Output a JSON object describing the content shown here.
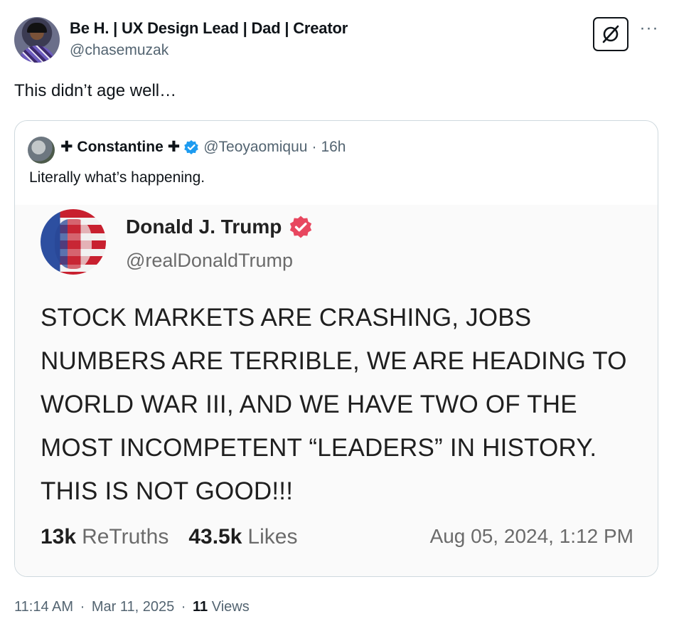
{
  "post": {
    "author_name": "Be H. | UX Design Lead | Dad | Creator",
    "author_handle": "@chasemuzak",
    "text": "This didn’t age well…",
    "more_label": "···",
    "time": "11:14 AM",
    "separator": "·",
    "date": "Mar 11, 2025",
    "views_count": "11",
    "views_label": "Views"
  },
  "quoted": {
    "name": "✚ Constantine ✚",
    "handle": "@Teoyaomiquu",
    "separator": "·",
    "age": "16h",
    "text": "Literally what’s happening.",
    "verified_color": "#1d9bf0"
  },
  "screenshot": {
    "name": "Donald J. Trump",
    "handle": "@realDonaldTrump",
    "body": "STOCK MARKETS ARE CRASHING, JOBS NUMBERS ARE TERRIBLE, WE ARE HEADING TO WORLD WAR III, AND WE HAVE TWO OF THE MOST INCOMPETENT “LEADERS” IN HISTORY. THIS IS NOT GOOD!!!",
    "retruths_count": "13k",
    "retruths_label": "ReTruths",
    "likes_count": "43.5k",
    "likes_label": "Likes",
    "timestamp": "Aug 05, 2024, 1:12 PM",
    "verified_color": "#e8475f"
  }
}
